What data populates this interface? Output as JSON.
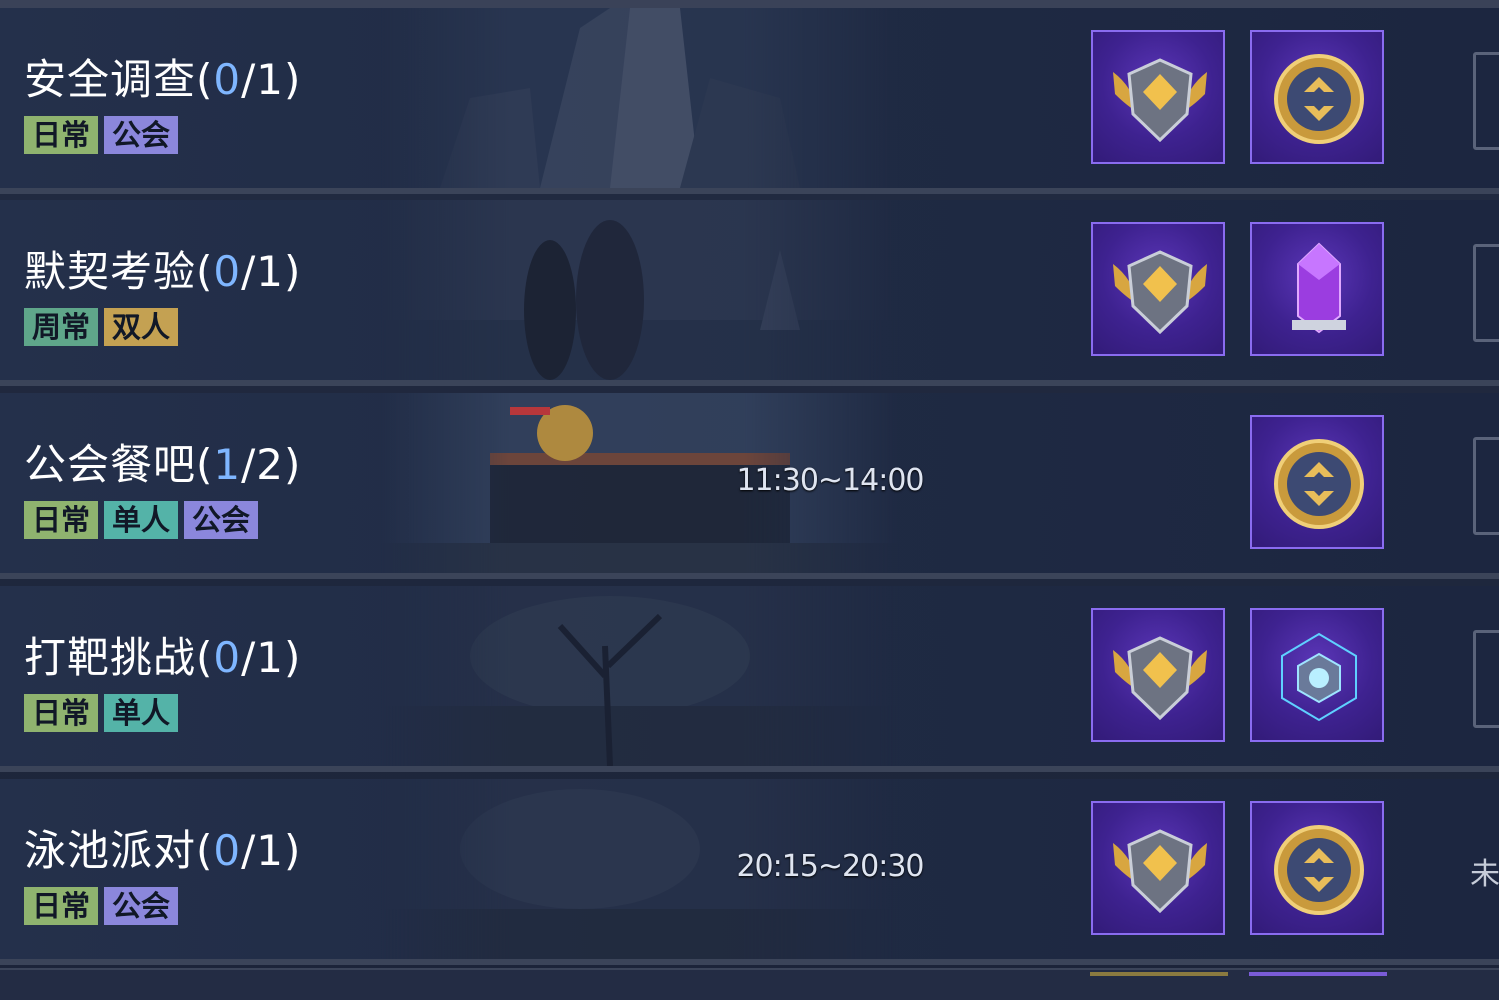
{
  "colors": {
    "tag_daily": "#8fb36f",
    "tag_guild": "#8b87dc",
    "tag_weekly": "#5fa68a",
    "tag_duo": "#c4a152",
    "tag_solo": "#54b3a8",
    "progress_current": "#7fb6ff"
  },
  "tasks": [
    {
      "name": "安全调查",
      "open_paren": "(",
      "current": "0",
      "total": "/1)",
      "tags": [
        {
          "label": "日常",
          "color": "#8fb36f"
        },
        {
          "label": "公会",
          "color": "#8b87dc"
        }
      ],
      "time": "",
      "rewards": [
        "winged-badge-icon",
        "gold-coin-icon"
      ]
    },
    {
      "name": "默契考验",
      "open_paren": "(",
      "current": "0",
      "total": "/1)",
      "tags": [
        {
          "label": "周常",
          "color": "#5fa68a"
        },
        {
          "label": "双人",
          "color": "#c4a152"
        }
      ],
      "time": "",
      "rewards": [
        "winged-badge-icon",
        "purple-crystal-icon"
      ]
    },
    {
      "name": "公会餐吧",
      "open_paren": "(",
      "current": "1",
      "total": "/2)",
      "tags": [
        {
          "label": "日常",
          "color": "#8fb36f"
        },
        {
          "label": "单人",
          "color": "#54b3a8"
        },
        {
          "label": "公会",
          "color": "#8b87dc"
        }
      ],
      "time": "11:30~14:00",
      "rewards": [
        "gold-coin-icon"
      ]
    },
    {
      "name": "打靶挑战",
      "open_paren": "(",
      "current": "0",
      "total": "/1)",
      "tags": [
        {
          "label": "日常",
          "color": "#8fb36f"
        },
        {
          "label": "单人",
          "color": "#54b3a8"
        }
      ],
      "time": "",
      "rewards": [
        "winged-badge-icon",
        "blue-cube-icon"
      ]
    },
    {
      "name": "泳池派对",
      "open_paren": "(",
      "current": "0",
      "total": "/1)",
      "tags": [
        {
          "label": "日常",
          "color": "#8fb36f"
        },
        {
          "label": "公会",
          "color": "#8b87dc"
        }
      ],
      "time": "20:15~20:30",
      "rewards": [
        "winged-badge-icon",
        "gold-coin-icon"
      ],
      "side_text": "未"
    }
  ]
}
